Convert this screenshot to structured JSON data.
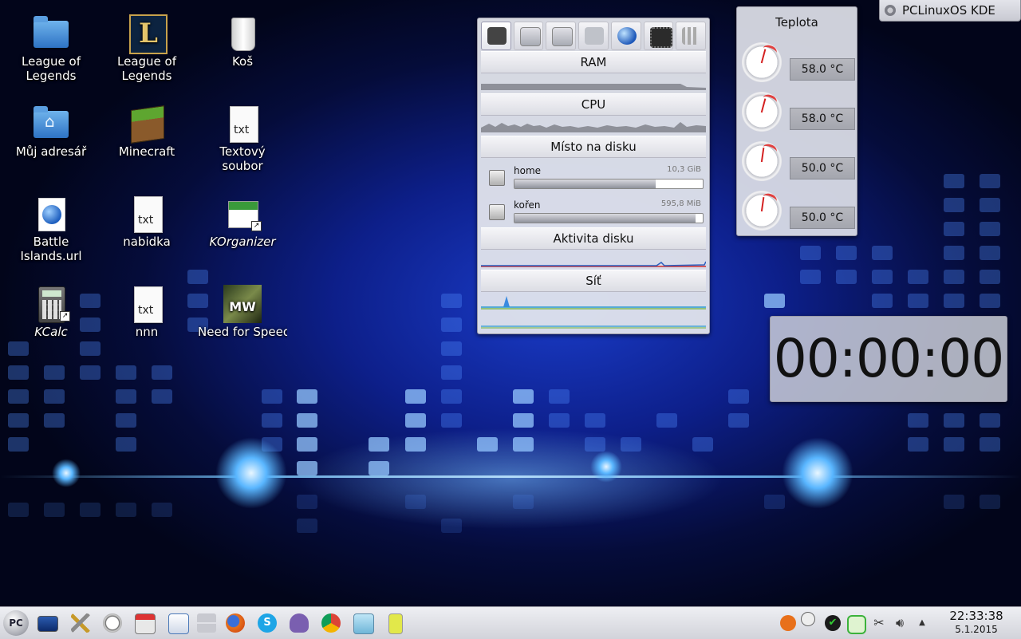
{
  "activity": {
    "label": "PCLinuxOS KDE"
  },
  "desktop_icons": [
    {
      "label": "League of Legends"
    },
    {
      "label": "League of Legends"
    },
    {
      "label": "Koš"
    },
    {
      "label": "Můj adresář"
    },
    {
      "label": "Minecraft"
    },
    {
      "label": "Textový soubor"
    },
    {
      "label": "Battle Islands.url"
    },
    {
      "label": "nabidka"
    },
    {
      "label": "KOrganizer"
    },
    {
      "label": "KCalc"
    },
    {
      "label": "nnn"
    },
    {
      "label": "Need for Speed™ Mos"
    }
  ],
  "file_type_text": "txt",
  "nfs_logo_text": "MW",
  "system_monitor": {
    "sections": {
      "ram": "RAM",
      "cpu": "CPU",
      "disk_space": "Místo na disku",
      "disk_activity": "Aktivita disku",
      "network": "Síť"
    },
    "disks": [
      {
        "name": "home",
        "size": "10,3 GiB",
        "usage_fraction": 0.75
      },
      {
        "name": "kořen",
        "size": "595,8 MiB",
        "usage_fraction": 0.96
      }
    ]
  },
  "temperature": {
    "title": "Teplota",
    "sensors": [
      {
        "value": "58.0 °C"
      },
      {
        "value": "58.0 °C"
      },
      {
        "value": "50.0 °C"
      },
      {
        "value": "50.0 °C"
      }
    ]
  },
  "stopwatch": {
    "value": "00:00:00"
  },
  "taskbar": {
    "start_label": "PC",
    "clock": {
      "time": "22:33:38",
      "date": "5.1.2015"
    }
  },
  "colors": {
    "accent": "#1a3cc9",
    "panel": "#e6e8ee"
  }
}
